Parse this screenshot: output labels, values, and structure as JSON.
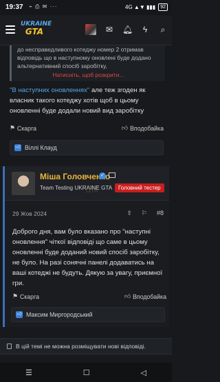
{
  "status": {
    "time": "19:37",
    "left_icons": "⌁ ⎙ ✉ ···",
    "signal": "4G ▲▼ ▮▮▮",
    "battery": "92"
  },
  "header": {
    "logo_line1": "UKRAINE",
    "logo_line2": "GTA"
  },
  "quote": {
    "text": "до несправедливого котеджу номер 2 отримав відповідь що в наступному оновлені буде додано альтернативний спосіб заробітку,",
    "expand": "Натисніть, щоб розкрити..."
  },
  "post1": {
    "link_text": "\"В наступних оновленнях\"",
    "text": " але теж згоден як власник такого котеджу хотів щоб в цьому оновленні буде додали новий вид заробітку",
    "report": "Скарга",
    "like": "Вподобайка",
    "reactions": "Віллі Клауд"
  },
  "post2": {
    "username": "Міша Головченко",
    "user_title": "Team Testing UKRAINE GTA",
    "role_badge": "Головний тестер",
    "watermark": "GTA",
    "date": "29 Жов 2024",
    "number": "#8",
    "body": "Доброго дня, вам було вказано про \"наступні оновлення\" чіткої відповіді що саме в цьому оновленні буде доданий новий спосіб заробітку, не було. На разі сонячні панелі додаватись на ваші котеджі не будуть. Дякую за увагу, приємної гри.",
    "report": "Скарга",
    "like": "Вподобайка",
    "reactions": "Максим Миргородський"
  },
  "footer_note": "В цій темі не можна розміщувати нові відповіді.",
  "navbar": {
    "menu": "☰",
    "home": "☐",
    "back": "◁"
  }
}
